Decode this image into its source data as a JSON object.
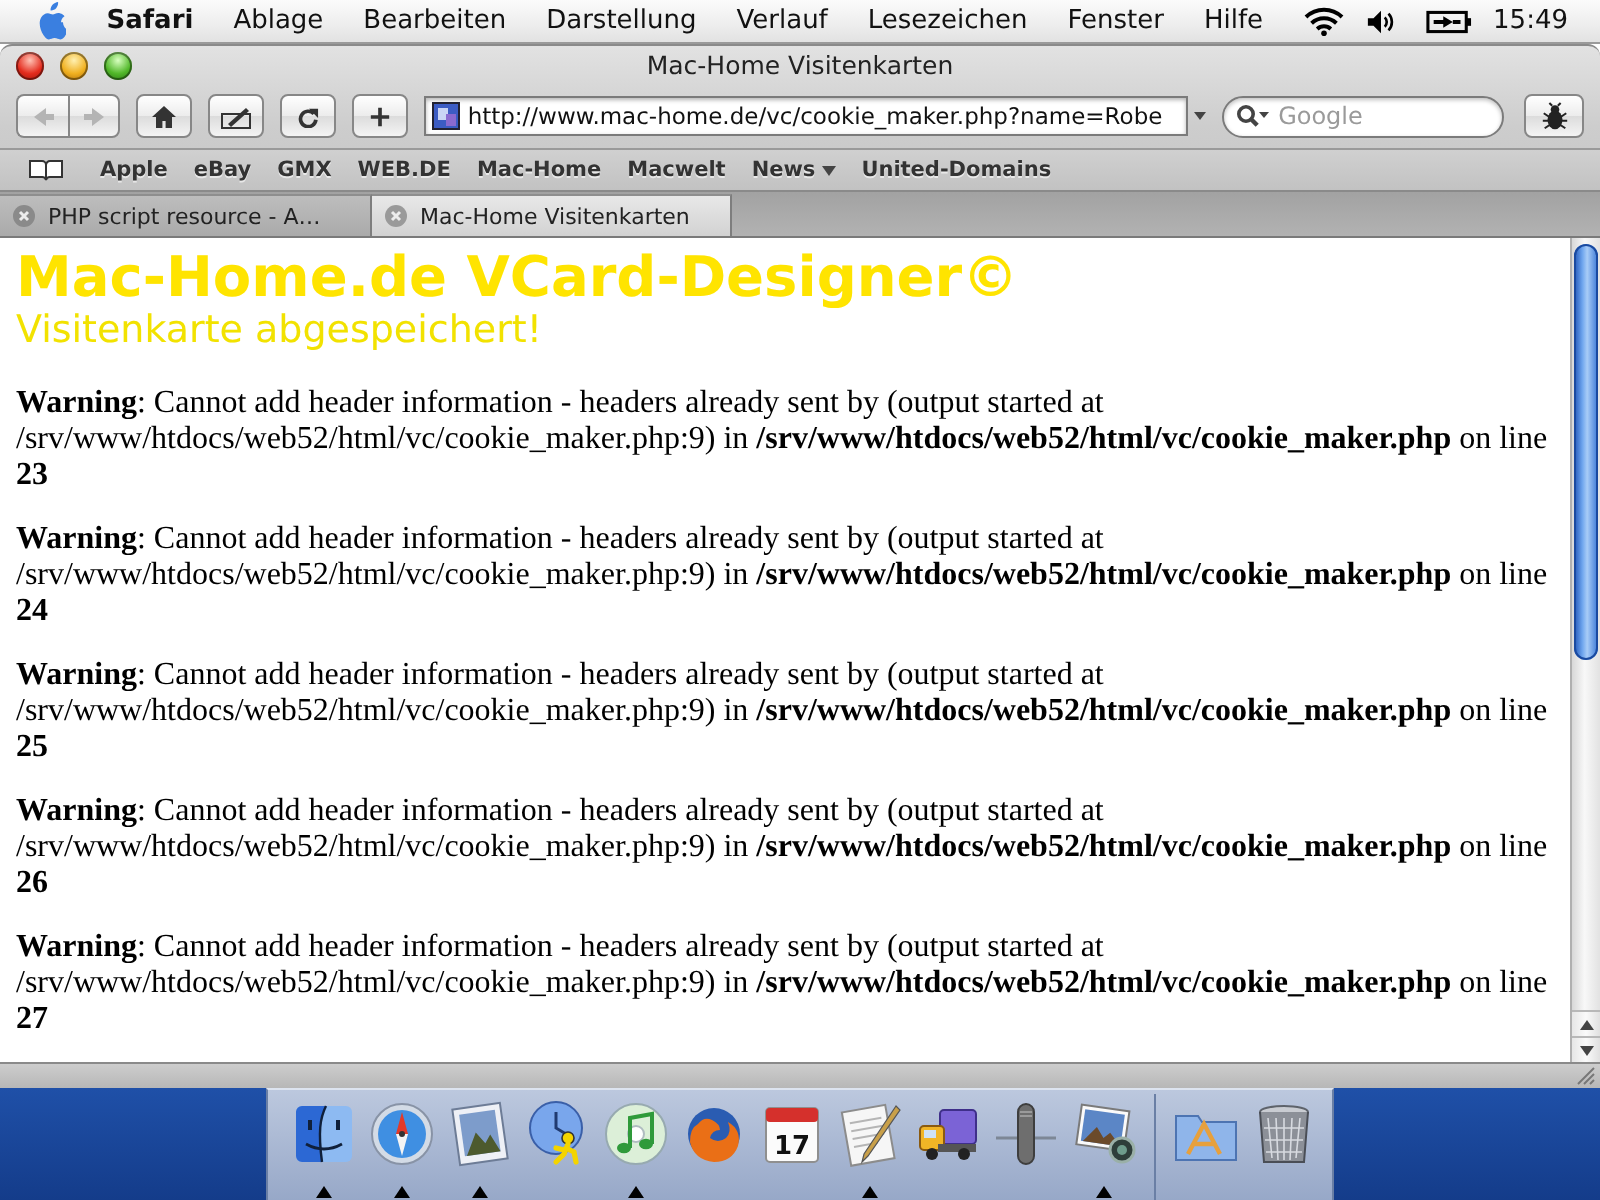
{
  "menu_bar": {
    "app_name": "Safari",
    "menus": [
      "Ablage",
      "Bearbeiten",
      "Darstellung",
      "Verlauf",
      "Lesezeichen",
      "Fenster",
      "Hilfe"
    ],
    "clock": "15:49"
  },
  "window": {
    "title": "Mac-Home Visitenkarten"
  },
  "toolbar": {
    "back": {
      "disabled": true
    },
    "forward": {
      "disabled": true
    },
    "address": "http://www.mac-home.de/vc/cookie_maker.php?name=Robe",
    "search": {
      "placeholder": "Google"
    }
  },
  "bookmarks": [
    {
      "label": "Apple",
      "menu": false
    },
    {
      "label": "eBay",
      "menu": false
    },
    {
      "label": "GMX",
      "menu": false
    },
    {
      "label": "WEB.DE",
      "menu": false
    },
    {
      "label": "Mac-Home",
      "menu": false
    },
    {
      "label": "Macwelt",
      "menu": false
    },
    {
      "label": "News",
      "menu": true
    },
    {
      "label": "United-Domains",
      "menu": false
    }
  ],
  "tabs": [
    {
      "label": "PHP script resource - A…",
      "selected": false
    },
    {
      "label": "Mac-Home Visitenkarten",
      "selected": true
    }
  ],
  "page": {
    "heading": "Mac-Home.de VCard-Designer©",
    "subheading": "Visitenkarte abgespeichert!",
    "warnings": [
      "**Warning**: Cannot add header information - headers already sent by (output started at /srv/www/htdocs/web52/html/vc/cookie_maker.php:9) in **/srv/www/htdocs/web52/html/vc/cookie_maker.php** on line **23**",
      "**Warning**: Cannot add header information - headers already sent by (output started at /srv/www/htdocs/web52/html/vc/cookie_maker.php:9) in **/srv/www/htdocs/web52/html/vc/cookie_maker.php** on line **24**",
      "**Warning**: Cannot add header information - headers already sent by (output started at /srv/www/htdocs/web52/html/vc/cookie_maker.php:9) in **/srv/www/htdocs/web52/html/vc/cookie_maker.php** on line **25**",
      "**Warning**: Cannot add header information - headers already sent by (output started at /srv/www/htdocs/web52/html/vc/cookie_maker.php:9) in **/srv/www/htdocs/web52/html/vc/cookie_maker.php** on line **26**",
      "**Warning**: Cannot add header information - headers already sent by (output started at /srv/www/htdocs/web52/html/vc/cookie_maker.php:9) in **/srv/www/htdocs/web52/html/vc/cookie_maker.php** on line **27**"
    ]
  },
  "dock": {
    "apps": [
      {
        "kind": "finder",
        "running": true
      },
      {
        "kind": "safari",
        "running": true
      },
      {
        "kind": "preview",
        "running": true
      },
      {
        "kind": "chat",
        "running": false
      },
      {
        "kind": "music",
        "running": true
      },
      {
        "kind": "firefox",
        "running": false
      },
      {
        "kind": "calendar",
        "running": false,
        "date": "17"
      },
      {
        "kind": "editor",
        "running": true
      },
      {
        "kind": "delivery",
        "running": false
      },
      {
        "kind": "microphone",
        "running": false
      },
      {
        "kind": "photos",
        "running": true
      }
    ],
    "stacks": [
      {
        "kind": "folder"
      },
      {
        "kind": "trash"
      }
    ]
  }
}
